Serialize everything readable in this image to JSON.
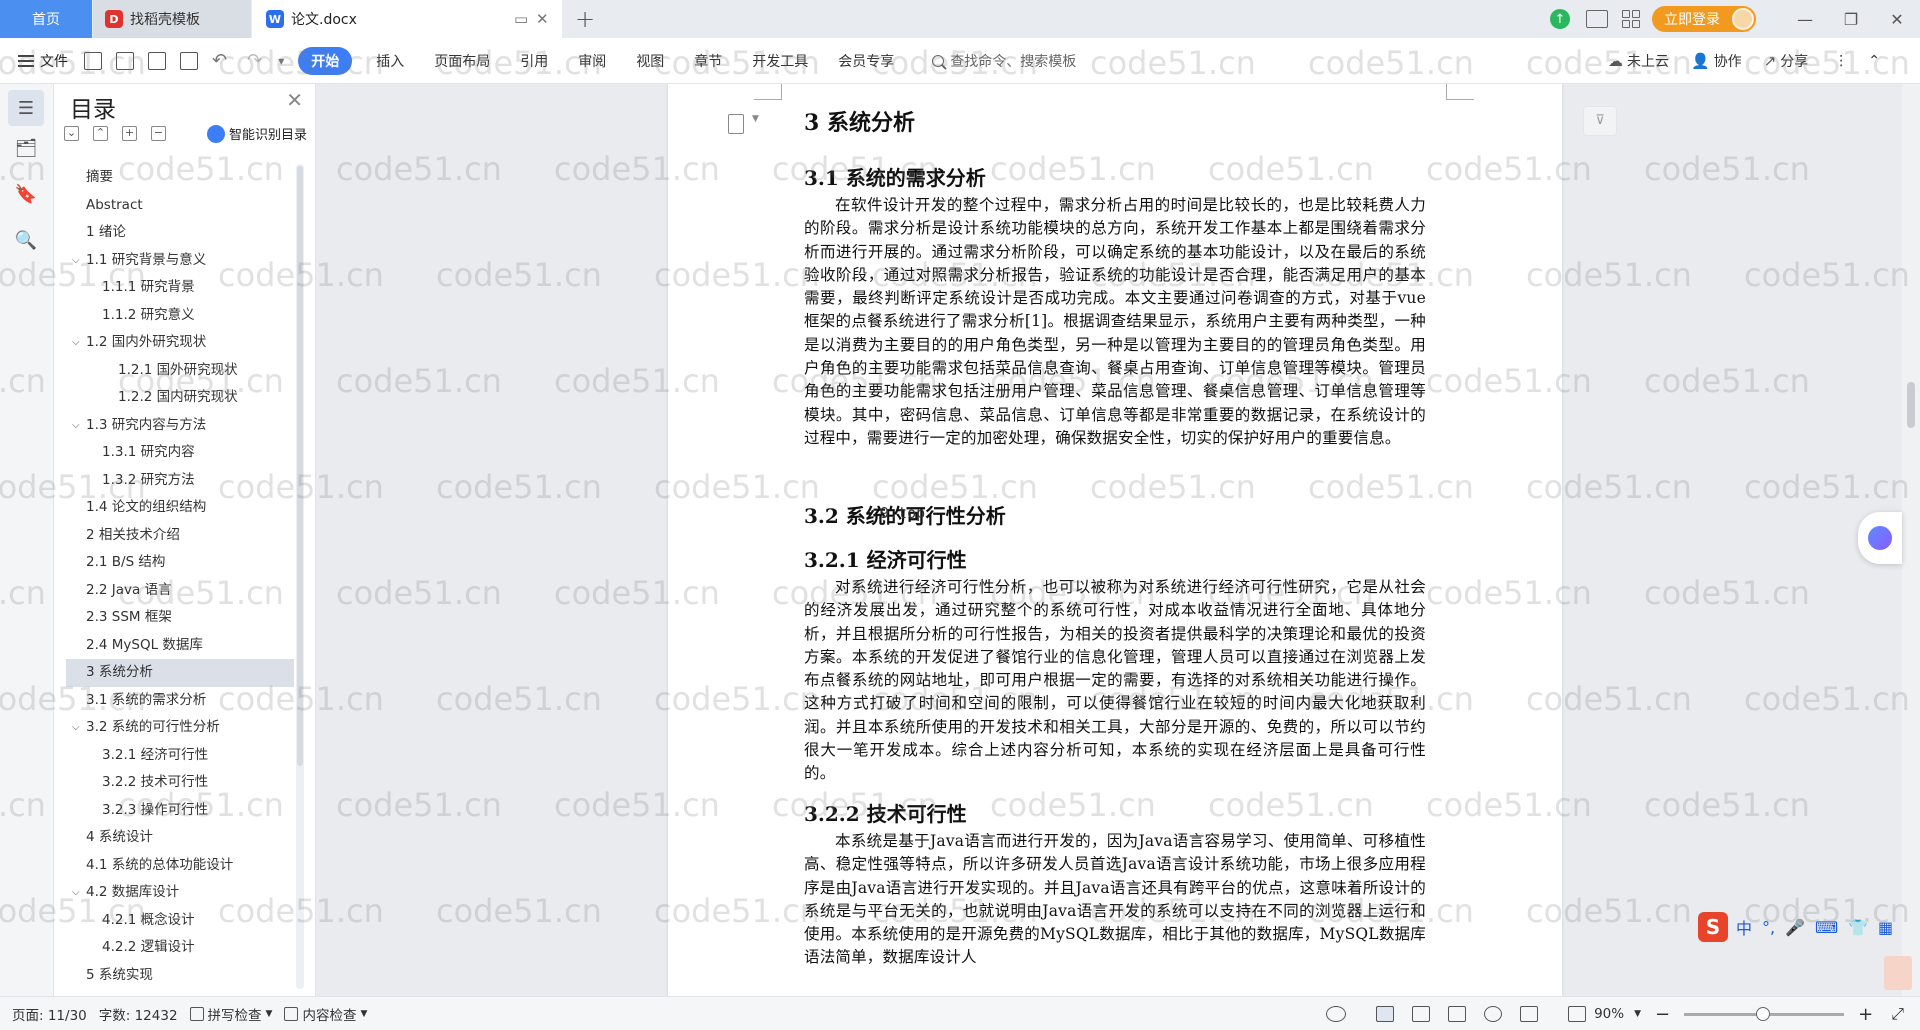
{
  "tabs": {
    "home": "首页",
    "template": "找稻壳模板",
    "template_logo": "D",
    "doc": "论文.docx",
    "doc_logo": "W"
  },
  "titlebar": {
    "login": "立即登录"
  },
  "menu": {
    "file": "文件",
    "items": [
      "开始",
      "插入",
      "页面布局",
      "引用",
      "审阅",
      "视图",
      "章节",
      "开发工具",
      "会员专享"
    ],
    "search": "查找命令、搜索模板",
    "cloud": "未上云",
    "collab": "协作",
    "share": "分享"
  },
  "toc": {
    "title": "目录",
    "smart": "智能识别目录",
    "items": [
      {
        "label": "摘要",
        "level": 1,
        "chev": false,
        "active": false
      },
      {
        "label": "Abstract",
        "level": 1,
        "chev": false,
        "active": false
      },
      {
        "label": "1 绪论",
        "level": 1,
        "chev": false,
        "active": false
      },
      {
        "label": "1.1 研究背景与意义",
        "level": 1,
        "chev": true,
        "active": false
      },
      {
        "label": "1.1.1 研究背景",
        "level": 2,
        "chev": false,
        "active": false
      },
      {
        "label": "1.1.2 研究意义",
        "level": 2,
        "chev": false,
        "active": false
      },
      {
        "label": "1.2 国内外研究现状",
        "level": 1,
        "chev": true,
        "active": false
      },
      {
        "label": "1.2.1 国外研究现状",
        "level": 3,
        "chev": false,
        "active": false
      },
      {
        "label": "1.2.2 国内研究现状",
        "level": 3,
        "chev": false,
        "active": false
      },
      {
        "label": "1.3 研究内容与方法",
        "level": 1,
        "chev": true,
        "active": false
      },
      {
        "label": "1.3.1 研究内容",
        "level": 2,
        "chev": false,
        "active": false
      },
      {
        "label": "1.3.2 研究方法",
        "level": 2,
        "chev": false,
        "active": false
      },
      {
        "label": "1.4 论文的组织结构",
        "level": 1,
        "chev": false,
        "active": false
      },
      {
        "label": "2 相关技术介绍",
        "level": 1,
        "chev": false,
        "active": false
      },
      {
        "label": "2.1 B/S 结构",
        "level": 1,
        "chev": false,
        "active": false
      },
      {
        "label": "2.2 Java 语言",
        "level": 1,
        "chev": false,
        "active": false
      },
      {
        "label": "2.3 SSM 框架",
        "level": 1,
        "chev": false,
        "active": false
      },
      {
        "label": "2.4 MySQL 数据库",
        "level": 1,
        "chev": false,
        "active": false
      },
      {
        "label": "3 系统分析",
        "level": 1,
        "chev": false,
        "active": true
      },
      {
        "label": "3.1 系统的需求分析",
        "level": 1,
        "chev": false,
        "active": false
      },
      {
        "label": "3.2 系统的可行性分析",
        "level": 1,
        "chev": true,
        "active": false
      },
      {
        "label": "3.2.1 经济可行性",
        "level": 2,
        "chev": false,
        "active": false
      },
      {
        "label": "3.2.2 技术可行性",
        "level": 2,
        "chev": false,
        "active": false
      },
      {
        "label": "3.2.3 操作可行性",
        "level": 2,
        "chev": false,
        "active": false
      },
      {
        "label": "4 系统设计",
        "level": 1,
        "chev": false,
        "active": false
      },
      {
        "label": "4.1 系统的总体功能设计",
        "level": 1,
        "chev": false,
        "active": false
      },
      {
        "label": "4.2 数据库设计",
        "level": 1,
        "chev": true,
        "active": false
      },
      {
        "label": "4.2.1 概念设计",
        "level": 2,
        "chev": false,
        "active": false
      },
      {
        "label": "4.2.2 逻辑设计",
        "level": 2,
        "chev": false,
        "active": false
      },
      {
        "label": "5 系统实现",
        "level": 1,
        "chev": false,
        "active": false
      }
    ]
  },
  "document": {
    "h_3": "3 系统分析",
    "h_3_1": "3.1 系统的需求分析",
    "p_3_1": "在软件设计开发的整个过程中，需求分析占用的时间是比较长的，也是比较耗费人力的阶段。需求分析是设计系统功能模块的总方向，系统开发工作基本上都是围绕着需求分析而进行开展的。通过需求分析阶段，可以确定系统的基本功能设计，以及在最后的系统验收阶段，通过对照需求分析报告，验证系统的功能设计是否合理，能否满足用户的基本需要，最终判断评定系统设计是否成功完成。本文主要通过问卷调查的方式，对基于vue框架的点餐系统进行了需求分析[1]。根据调查结果显示，系统用户主要有两种类型，一种是以消费为主要目的的用户角色类型，另一种是以管理为主要目的的管理员角色类型。用户角色的主要功能需求包括菜品信息查询、餐桌占用查询、订单信息管理等模块。管理员角色的主要功能需求包括注册用户管理、菜品信息管理、餐桌信息管理、订单信息管理等模块。其中，密码信息、菜品信息、订单信息等都是非常重要的数据记录，在系统设计的过程中，需要进行一定的加密处理，确保数据安全性，切实的保护好用户的重要信息。",
    "h_3_2": "3.2 系统的可行性分析",
    "h_3_2_1": "3.2.1 经济可行性",
    "p_3_2_1": "对系统进行经济可行性分析，也可以被称为对系统进行经济可行性研究，它是从社会的经济发展出发，通过研究整个的系统可行性，对成本收益情况进行全面地、具体地分析，并且根据所分析的可行性报告，为相关的投资者提供最科学的决策理论和最优的投资方案。本系统的开发促进了餐馆行业的信息化管理，管理人员可以直接通过在浏览器上发布点餐系统的网站地址，即可用户根据一定的需要，有选择的对系统相关功能进行操作。这种方式打破了时间和空间的限制，可以使得餐馆行业在较短的时间内最大化地获取利润。并且本系统所使用的开发技术和相关工具，大部分是开源的、免费的，所以可以节约很大一笔开发成本。综合上述内容分析可知，本系统的实现在经济层面上是具备可行性的。",
    "h_3_2_2": "3.2.2 技术可行性",
    "p_3_2_2": "本系统是基于Java语言而进行开发的，因为Java语言容易学习、使用简单、可移植性高、稳定性强等特点，所以许多研发人员首选Java语言设计系统功能，市场上很多应用程序是由Java语言进行开发实现的。并且Java语言还具有跨平台的优点，这意味着所设计的系统是与平台无关的，也就说明由Java语言开发的系统可以支持在不同的浏览器上运行和使用。本系统使用的是开源免费的MySQL数据库，相比于其他的数据库，MySQL数据库语法简单，数据库设计人",
    "cursor_tip": "9.top"
  },
  "ime": {
    "logo": "S",
    "lang": "中"
  },
  "status": {
    "page": "页面: 11/30",
    "words": "字数: 12432",
    "spell": "拼写检查",
    "content_check": "内容检查",
    "zoom": "90%"
  },
  "watermark": "code51.cn"
}
